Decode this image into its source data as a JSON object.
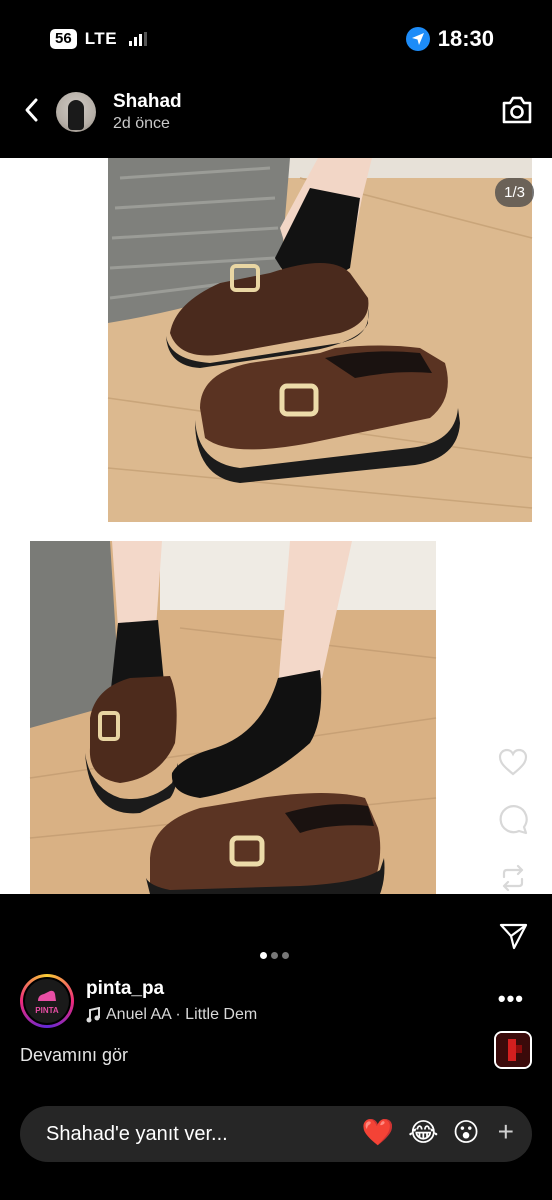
{
  "status_bar": {
    "network_badge": "56",
    "network_type": "LTE",
    "time": "18:30"
  },
  "header": {
    "username": "Shahad",
    "timestamp": "2d önce"
  },
  "story": {
    "photo_counter": "1/3"
  },
  "music_sticker": {
    "account": "pinta_pa",
    "avatar_text": "PINTA",
    "song": "Anuel AA · Little Dem",
    "more": "•••"
  },
  "caption": {
    "see_more": "Devamını gör"
  },
  "reply_bar": {
    "placeholder": "Shahad'e yanıt ver...",
    "emojis": [
      "❤️",
      "😂",
      "😮"
    ],
    "add": "+"
  },
  "icons": {
    "back": "chevron-left-icon",
    "camera": "camera-icon",
    "location": "location-arrow-icon",
    "like": "heart-icon",
    "comment": "comment-icon",
    "repost": "repost-icon",
    "share": "send-icon",
    "music": "music-note-icon"
  }
}
